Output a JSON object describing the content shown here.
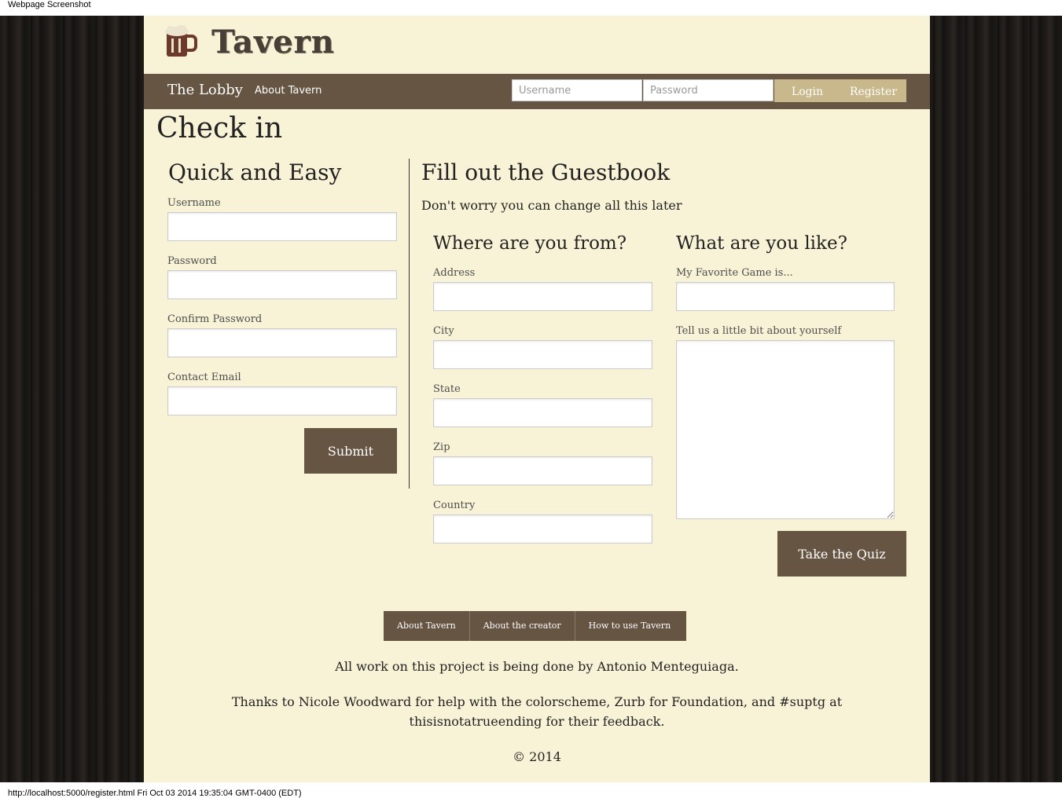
{
  "browser": {
    "header_title": "Webpage Screenshot",
    "footer_text": "http://localhost:5000/register.html Fri Oct 03 2014 19:35:04 GMT-0400 (EDT)"
  },
  "brand": {
    "name": "Tavern",
    "logo_icon": "beer-mug-icon"
  },
  "nav": {
    "lobby": "The Lobby",
    "about": "About Tavern",
    "username_placeholder": "Username",
    "password_placeholder": "Password",
    "login": "Login",
    "register": "Register"
  },
  "page_title": "Check in",
  "quick": {
    "title": "Quick and Easy",
    "username_label": "Username",
    "password_label": "Password",
    "confirm_label": "Confirm Password",
    "email_label": "Contact Email",
    "submit": "Submit"
  },
  "guestbook": {
    "title": "Fill out the Guestbook",
    "subtitle": "Don't worry you can change all this later",
    "from": {
      "title": "Where are you from?",
      "address_label": "Address",
      "city_label": "City",
      "state_label": "State",
      "zip_label": "Zip",
      "country_label": "Country"
    },
    "like": {
      "title": "What are you like?",
      "game_label": "My Favorite Game is...",
      "about_label": "Tell us a little bit about yourself",
      "quiz": "Take the Quiz"
    }
  },
  "footer": {
    "links": [
      "About Tavern",
      "About the creator",
      "How to use Tavern"
    ],
    "credit": "All work on this project is being done by Antonio Menteguiaga.",
    "thanks": "Thanks to Nicole Woodward for help with the colorscheme, Zurb for Foundation, and #suptg at thisisnotatrueending for their feedback.",
    "copyright": "© 2014"
  },
  "colors": {
    "page_bg": "#f8f3d6",
    "nav_bg": "#675544",
    "nav_button": "#c9b88b",
    "wood": "#1a1715"
  }
}
